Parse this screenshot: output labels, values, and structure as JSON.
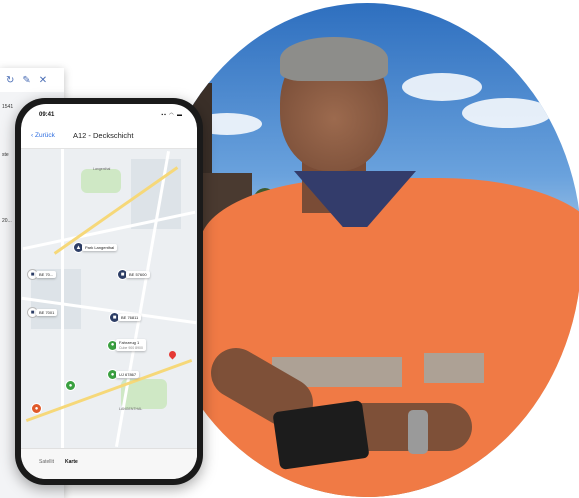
{
  "phone": {
    "status_time": "09:41",
    "nav": {
      "back_label": "Zurück",
      "title": "A12 - Deckschicht"
    },
    "tabs": [
      {
        "label": "Satellit"
      },
      {
        "label": "Karte"
      }
    ]
  },
  "map": {
    "markers": [
      {
        "label": "Park Langenthal",
        "color": "#2d3e66"
      },
      {
        "label": "BE 70...",
        "color": "#ffffff"
      },
      {
        "label": "BE 57600",
        "color": "#2d3e66"
      },
      {
        "label": "BE 7001",
        "color": "#ffffff"
      },
      {
        "label": "BE 76811",
        "color": "#2d3e66"
      },
      {
        "label": "Fahrzeug 1",
        "sublabel": "Cube 900 8900",
        "color": "#3aa040"
      },
      {
        "label": "UJ 67867",
        "color": "#3aa040"
      },
      {
        "label": "",
        "color": "#3aa040"
      },
      {
        "label": "",
        "color": "#e05a2a"
      }
    ],
    "place_labels": [
      "Langenthal",
      "LANGENTHAL"
    ]
  },
  "desktop_panel": {
    "toolbar_icons": [
      "refresh-icon",
      "pin-icon",
      "close-icon"
    ],
    "text_fragments": [
      "1541",
      "ste",
      "20..."
    ]
  }
}
